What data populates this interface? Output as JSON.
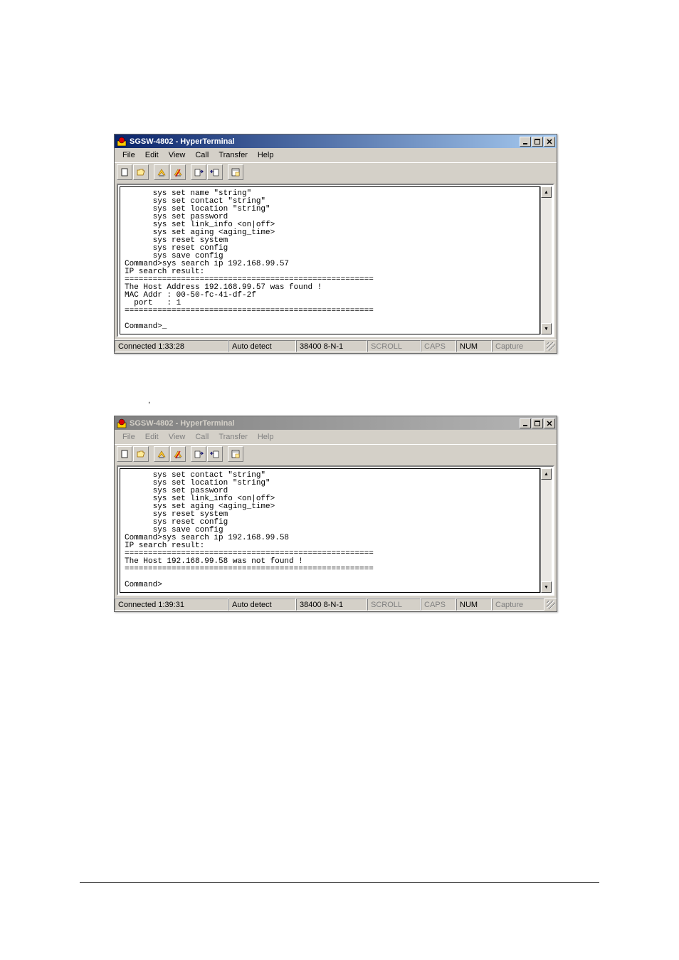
{
  "window1": {
    "title": "SGSW-4802 - HyperTerminal",
    "menus": [
      "File",
      "Edit",
      "View",
      "Call",
      "Transfer",
      "Help"
    ],
    "terminal": "      sys set name \"string\"\n      sys set contact \"string\"\n      sys set location \"string\"\n      sys set password\n      sys set link_info <on|off>\n      sys set aging <aging_time>\n      sys reset system\n      sys reset config\n      sys save config\nCommand>sys search ip 192.168.99.57\nIP search result:\n=====================================================\nThe Host Address 192.168.99.57 was found !\nMAC Addr : 00-50-fc-41-df-2f\n  port   : 1\n=====================================================\n\nCommand>_",
    "status": {
      "connected": "Connected 1:33:28",
      "detect": "Auto detect",
      "baud": "38400 8-N-1",
      "scroll": "SCROLL",
      "caps": "CAPS",
      "num": "NUM",
      "capture": "Capture"
    }
  },
  "caption1": ",",
  "window2": {
    "title": "SGSW-4802 - HyperTerminal",
    "menus": [
      "File",
      "Edit",
      "View",
      "Call",
      "Transfer",
      "Help"
    ],
    "terminal": "      sys set contact \"string\"\n      sys set location \"string\"\n      sys set password\n      sys set link_info <on|off>\n      sys set aging <aging_time>\n      sys reset system\n      sys reset config\n      sys save config\nCommand>sys search ip 192.168.99.58\nIP search result:\n=====================================================\nThe Host 192.168.99.58 was not found !\n=====================================================\n\nCommand>",
    "status": {
      "connected": "Connected 1:39:31",
      "detect": "Auto detect",
      "baud": "38400 8-N-1",
      "scroll": "SCROLL",
      "caps": "CAPS",
      "num": "NUM",
      "capture": "Capture"
    }
  }
}
